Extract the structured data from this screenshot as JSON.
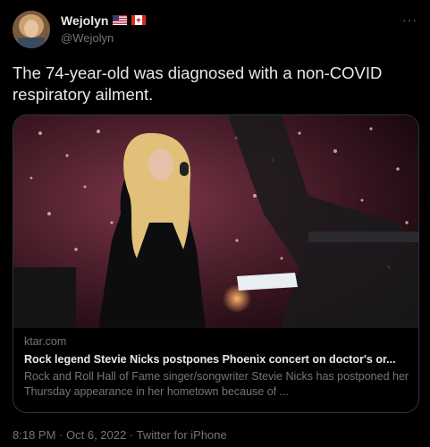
{
  "user": {
    "display_name": "Wejolyn",
    "handle": "@Wejolyn",
    "flags": [
      "us-flag-icon",
      "canada-flag-icon"
    ]
  },
  "menu": {
    "more_label": "···"
  },
  "tweet": {
    "text": "The 74-year-old was diagnosed with a non-COVID respiratory ailment."
  },
  "card": {
    "domain": "ktar.com",
    "title": "Rock legend Stevie Nicks postpones Phoenix concert on doctor's or...",
    "description": "Rock and Roll Hall of Fame singer/songwriter Stevie Nicks has postponed her Thursday appearance in her hometown because of ..."
  },
  "meta": {
    "time": "8:18 PM",
    "date": "Oct 6, 2022",
    "source": "Twitter for iPhone",
    "separator": "·"
  }
}
